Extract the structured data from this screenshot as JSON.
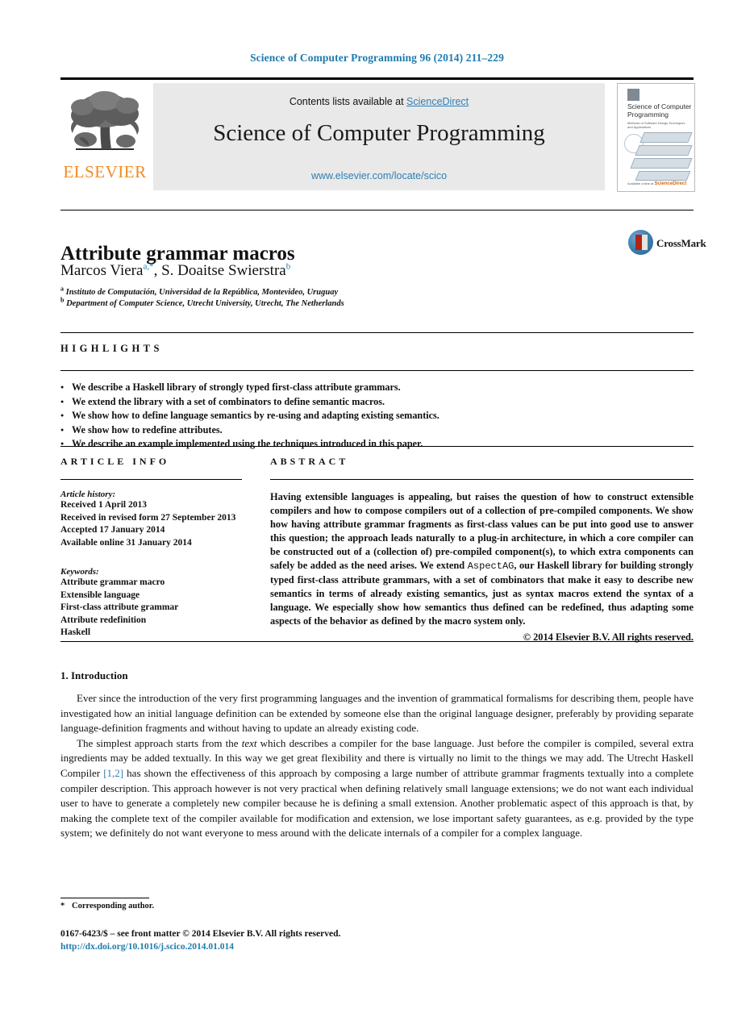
{
  "running_head": "Science of Computer Programming 96 (2014) 211–229",
  "masthead": {
    "contents_prefix": "Contents lists available at ",
    "sciencedirect_link": "ScienceDirect",
    "journal_title": "Science of Computer Programming",
    "journal_url": "www.elsevier.com/locate/scico",
    "publisher_name": "ELSEVIER",
    "cover": {
      "title": "Science of Computer Programming",
      "subtitle": "Methods of Software Design Techniques and Applications",
      "footer_text": "Available online at",
      "footer_brand": "ScienceDirect"
    }
  },
  "article": {
    "title": "Attribute grammar macros",
    "authors_html": "Marcos Viera<sup>a,*</sup>, S. Doaitse Swierstra<sup>b</sup>",
    "affiliations": [
      {
        "marker": "a",
        "text": "Instituto de Computación, Universidad de la República, Montevideo, Uruguay"
      },
      {
        "marker": "b",
        "text": "Department of Computer Science, Utrecht University, Utrecht, The Netherlands"
      }
    ],
    "crossmark_label": "CrossMark"
  },
  "highlights": {
    "label": "HIGHLIGHTS",
    "items": [
      "We describe a Haskell library of strongly typed first-class attribute grammars.",
      "We extend the library with a set of combinators to define semantic macros.",
      "We show how to define language semantics by re-using and adapting existing semantics.",
      "We show how to redefine attributes.",
      "We describe an example implemented using the techniques introduced in this paper."
    ]
  },
  "article_info": {
    "label": "ARTICLE INFO",
    "history_heading": "Article history:",
    "history": [
      "Received 1 April 2013",
      "Received in revised form 27 September 2013",
      "Accepted 17 January 2014",
      "Available online 31 January 2014"
    ],
    "keywords_heading": "Keywords:",
    "keywords": [
      "Attribute grammar macro",
      "Extensible language",
      "First-class attribute grammar",
      "Attribute redefinition",
      "Haskell"
    ]
  },
  "abstract": {
    "label": "ABSTRACT",
    "text_html": "Having extensible languages is appealing, but raises the question of how to construct extensible compilers and how to compose compilers out of a collection of pre-compiled components. We show how having attribute grammar fragments as first-class values can be put into good use to answer this question; the approach leads naturally to a plug-in architecture, in which a core compiler can be constructed out of a (collection of) pre-compiled component(s), to which extra components can safely be added as the need arises. We extend <span class=\"mono\">AspectAG</span>, our Haskell library for building strongly typed first-class attribute grammars, with a set of combinators that make it easy to describe new semantics in terms of already existing semantics, just as syntax macros extend the syntax of a language. We especially show how semantics thus defined can be redefined, thus adapting some aspects of the behavior as defined by the macro system only.",
    "copyright": "© 2014 Elsevier B.V. All rights reserved."
  },
  "body": {
    "section_heading": "1. Introduction",
    "paragraph1": "Ever since the introduction of the very first programming languages and the invention of grammatical formalisms for describing them, people have investigated how an initial language definition can be extended by someone else than the original language designer, preferably by providing separate language-definition fragments and without having to update an already existing code.",
    "paragraph2_html": "The simplest approach starts from the <i>text</i> which describes a compiler for the base language. Just before the compiler is compiled, several extra ingredients may be added textually. In this way we get great flexibility and there is virtually no limit to the things we may add. The Utrecht Haskell Compiler <span class=\"cite\">[1,2]</span> has shown the effectiveness of this approach by composing a large number of attribute grammar fragments textually into a complete compiler description. This approach however is not very practical when defining relatively small language extensions; we do not want each individual user to have to generate a completely new compiler because he is defining a small extension. Another problematic aspect of this approach is that, by making the complete text of the compiler available for modification and extension, we lose important safety guarantees, as e.g. provided by the type system; we definitely do not want everyone to mess around with the delicate internals of a compiler for a complex language."
  },
  "footer": {
    "corresponding_author": "Corresponding author.",
    "issn_line": "0167-6423/$ – see front matter © 2014 Elsevier B.V. All rights reserved.",
    "doi": "http://dx.doi.org/10.1016/j.scico.2014.01.014"
  },
  "colors": {
    "link_blue": "#2e7fb5",
    "header_blue": "#1f7bad",
    "elsevier_orange": "#f08c24",
    "panel_grey": "#e9e9e9"
  }
}
